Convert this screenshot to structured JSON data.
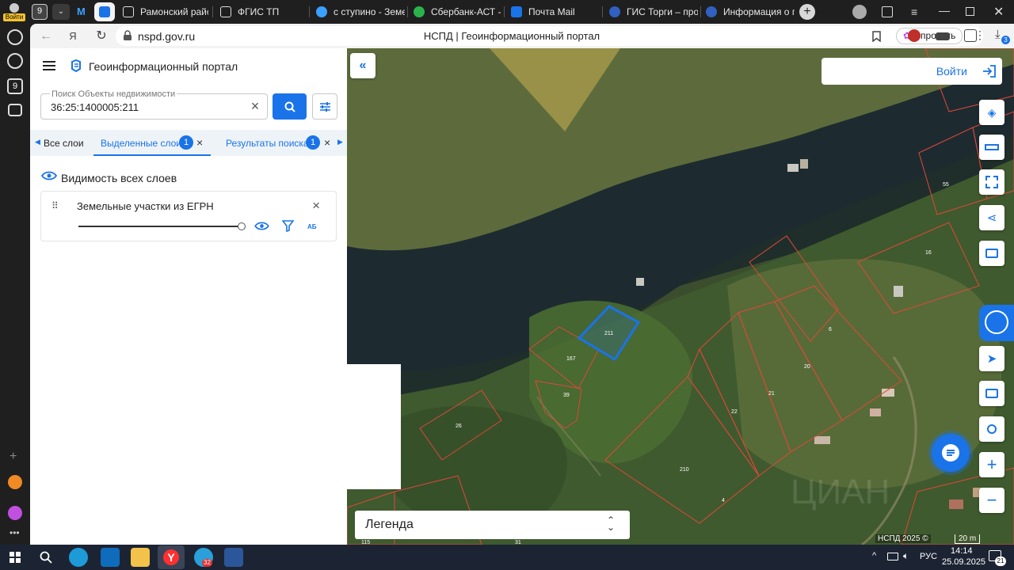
{
  "browser": {
    "profile_label": "Войти",
    "tabs": [
      {
        "title": "Рамонский район"
      },
      {
        "title": "ФГИС ТП"
      },
      {
        "title": "с ступино - Земел"
      },
      {
        "title": "Сбербанк-АСТ - Э"
      },
      {
        "title": "Почта Mail"
      },
      {
        "title": "ГИС Торги – прод"
      },
      {
        "title": "Информация о пр"
      }
    ],
    "tab_counter": "9",
    "url": "nspd.gov.ru",
    "page_title": "НСПД | Геоинформационный портал",
    "ask_label": "Спросить",
    "downloads_badge": "3",
    "rail_badge": "9"
  },
  "panel": {
    "portal_title": "Геоинформационный портал",
    "search": {
      "label": "Поиск Объекты недвижимости",
      "value": "36:25:1400005:211"
    },
    "tabs": [
      {
        "label": "Все слои"
      },
      {
        "label": "Выделенные слои",
        "count": "1"
      },
      {
        "label": "Результаты поиска",
        "count": "1"
      }
    ],
    "visibility_label": "Видимость всех слоев",
    "layer": {
      "name": "Земельные участки из ЕГРН",
      "opacity": 1.0
    }
  },
  "map": {
    "login_label": "Войти",
    "legend_label": "Легенда",
    "attribution": "НСПД 2025 ©",
    "scale_label": "20 m",
    "parcel_labels": [
      "211",
      "167",
      "39",
      "26",
      "55",
      "16",
      "6",
      "20",
      "21",
      "22",
      "210",
      "4",
      "31",
      "115"
    ],
    "watermark": "ЦИАН"
  },
  "taskbar": {
    "language": "РУС",
    "time": "14:14",
    "date": "25.09.2025",
    "notifications": "21",
    "telegram_badge": "32"
  },
  "colors": {
    "accent": "#1a73e8",
    "parcel_outline": "#e0473b",
    "selected_parcel": "#1a73e8"
  }
}
